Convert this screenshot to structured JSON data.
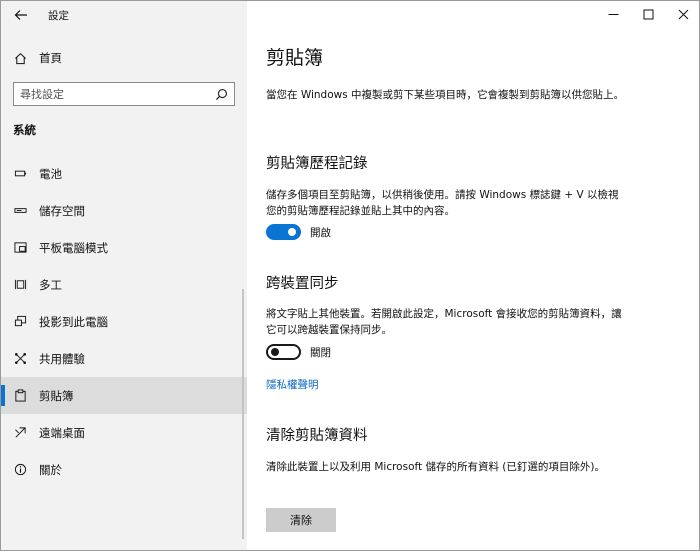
{
  "window": {
    "app_title": "設定"
  },
  "sidebar": {
    "home_label": "首頁",
    "search": {
      "placeholder": "尋找設定",
      "value": ""
    },
    "section": "系統",
    "items": [
      {
        "label": "電池",
        "icon": "battery-icon"
      },
      {
        "label": "儲存空間",
        "icon": "storage-icon"
      },
      {
        "label": "平板電腦模式",
        "icon": "tablet-mode-icon"
      },
      {
        "label": "多工",
        "icon": "multitasking-icon"
      },
      {
        "label": "投影到此電腦",
        "icon": "project-icon"
      },
      {
        "label": "共用體驗",
        "icon": "shared-experiences-icon"
      },
      {
        "label": "剪貼簿",
        "icon": "clipboard-icon",
        "selected": true
      },
      {
        "label": "遠端桌面",
        "icon": "remote-desktop-icon"
      },
      {
        "label": "關於",
        "icon": "info-icon"
      }
    ]
  },
  "main": {
    "title": "剪貼簿",
    "intro": "當您在 Windows 中複製或剪下某些項目時，它會複製到剪貼簿以供您貼上。",
    "history": {
      "title": "剪貼簿歷程記錄",
      "desc": "儲存多個項目至剪貼簿，以供稍後使用。請按 Windows 標誌鍵 + V 以檢視您的剪貼簿歷程記錄並貼上其中的內容。",
      "toggle_state": "on",
      "toggle_label": "開啟"
    },
    "sync": {
      "title": "跨裝置同步",
      "desc": "將文字貼上其他裝置。若開啟此設定，Microsoft 會接收您的剪貼簿資料，讓它可以跨越裝置保持同步。",
      "toggle_state": "off",
      "toggle_label": "關閉"
    },
    "privacy_link": "隱私權聲明",
    "clear": {
      "title": "清除剪貼簿資料",
      "desc": "清除此裝置上以及利用 Microsoft 儲存的所有資料 (已釘選的項目除外)。",
      "button_label": "清除"
    }
  },
  "colors": {
    "accent": "#0a74d2",
    "link": "#0a66c2",
    "sidebar_bg": "#f2f2f2",
    "selected_bg": "#dcdcdc"
  }
}
